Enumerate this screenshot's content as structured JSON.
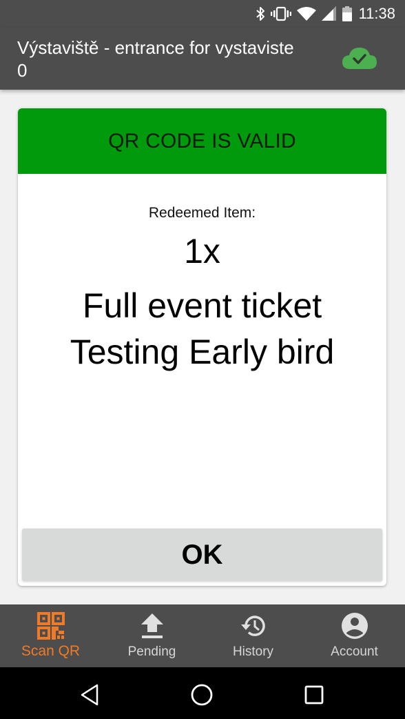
{
  "status_bar": {
    "time": "11:38",
    "icons": [
      "bluetooth-icon",
      "vibrate-icon",
      "wifi-icon",
      "cell-signal-icon",
      "battery-icon"
    ]
  },
  "app_bar": {
    "title": "Výstaviště - entrance for vystaviste 0",
    "sync_icon": "cloud-done-icon",
    "sync_color": "#4caf50"
  },
  "result": {
    "status": "QR CODE IS VALID",
    "status_color": "#009a0c",
    "redeemed_label": "Redeemed Item:",
    "quantity": "1x",
    "item_name_line1": "Full event ticket",
    "item_name_line2": "Testing Early bird",
    "ok_label": "OK"
  },
  "bottom_nav": {
    "active_color": "#f07a26",
    "items": [
      {
        "label": "Scan QR",
        "icon": "qr-code-icon",
        "active": true
      },
      {
        "label": "Pending",
        "icon": "upload-icon",
        "active": false
      },
      {
        "label": "History",
        "icon": "history-icon",
        "active": false
      },
      {
        "label": "Account",
        "icon": "account-circle-icon",
        "active": false
      }
    ]
  },
  "system_nav": {
    "buttons": [
      "back-icon",
      "home-icon",
      "recents-icon"
    ]
  }
}
